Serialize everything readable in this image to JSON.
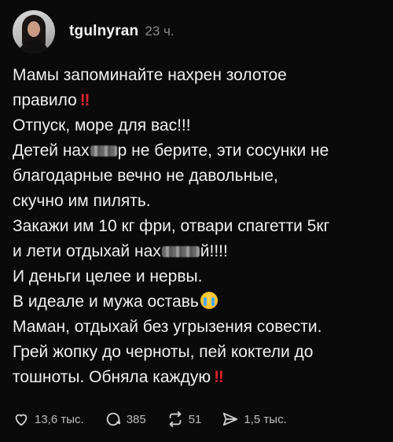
{
  "post": {
    "username": "tgulnyran",
    "time": "23 ч.",
    "lines": [
      "Мамы запоминайте нахрен золотое",
      "правило",
      "Отпуск, море для вас!!!",
      [
        "Детей нах",
        "р не берите, эти сосунки не"
      ],
      "благодарные вечно не давольные,",
      "скучно им пилять.",
      "Закажи им 10 кг фри, отвари спагетти 5кг",
      [
        "и лети отдыхай нах",
        "й!!!!"
      ],
      "И деньги целее и нервы.",
      "В идеале и мужа оставь",
      "Маман, отдыхай без угрызения совести.",
      "Грей жопку до черноты, пей коктели до",
      "тошноты. Обняла каждую"
    ],
    "emoji_bang": "‼"
  },
  "actions": {
    "likes": "13,6 тыс.",
    "comments": "385",
    "reposts": "51",
    "shares": "1,5 тыс."
  },
  "icons": [
    "avatar",
    "heart-icon",
    "comment-icon",
    "repost-icon",
    "share-icon",
    "crying-emoji-icon"
  ]
}
